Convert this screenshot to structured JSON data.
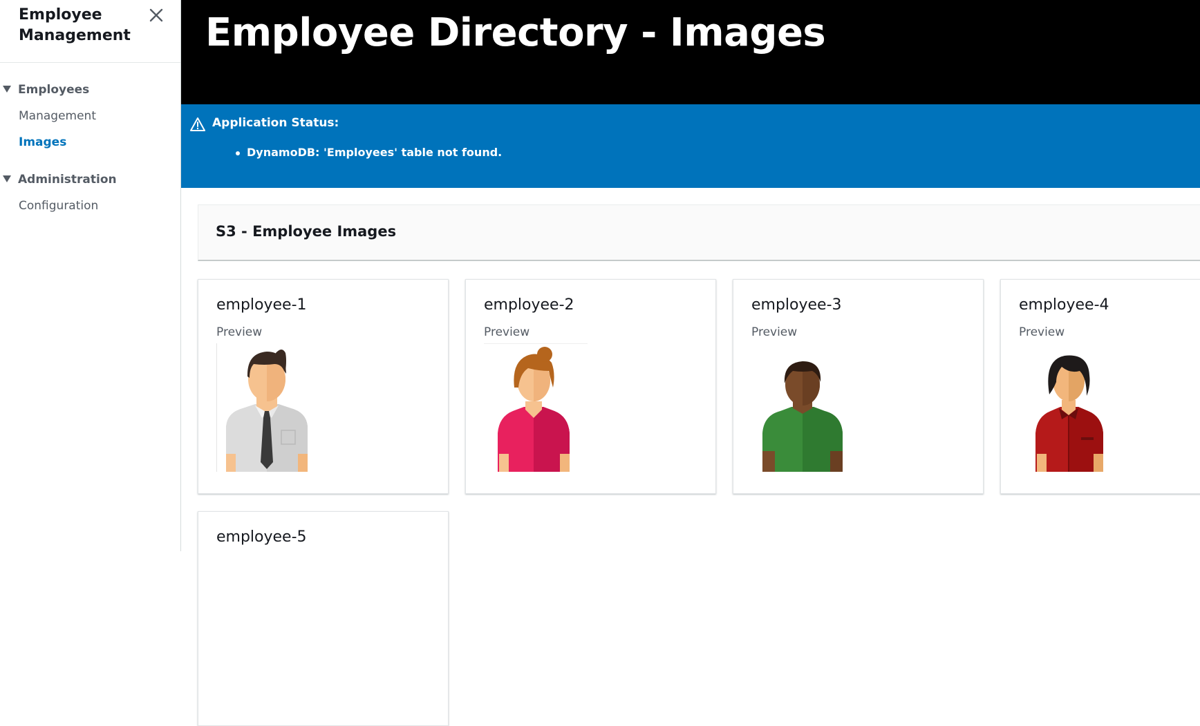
{
  "sidebar": {
    "title": "Employee Management",
    "sections": [
      {
        "label": "Employees",
        "items": [
          {
            "label": "Management"
          },
          {
            "label": "Images"
          }
        ]
      },
      {
        "label": "Administration",
        "items": [
          {
            "label": "Configuration"
          }
        ]
      }
    ],
    "active_item": "Images"
  },
  "header": {
    "title": "Employee Directory - Images"
  },
  "status": {
    "title": "Application Status:",
    "messages": [
      "DynamoDB: 'Employees' table not found."
    ],
    "color": "#0073bb"
  },
  "container": {
    "title": "S3 - Employee Images"
  },
  "cards": [
    {
      "name": "employee-1",
      "label": "Preview",
      "icon": "man-white-shirt-tie-avatar"
    },
    {
      "name": "employee-2",
      "label": "Preview",
      "icon": "woman-pink-shirt-avatar"
    },
    {
      "name": "employee-3",
      "label": "Preview",
      "icon": "man-green-shirt-avatar"
    },
    {
      "name": "employee-4",
      "label": "Preview",
      "icon": "woman-red-shirt-avatar"
    },
    {
      "name": "employee-5"
    }
  ],
  "colors": {
    "accent": "#0073bb",
    "header_bg": "#000000"
  }
}
